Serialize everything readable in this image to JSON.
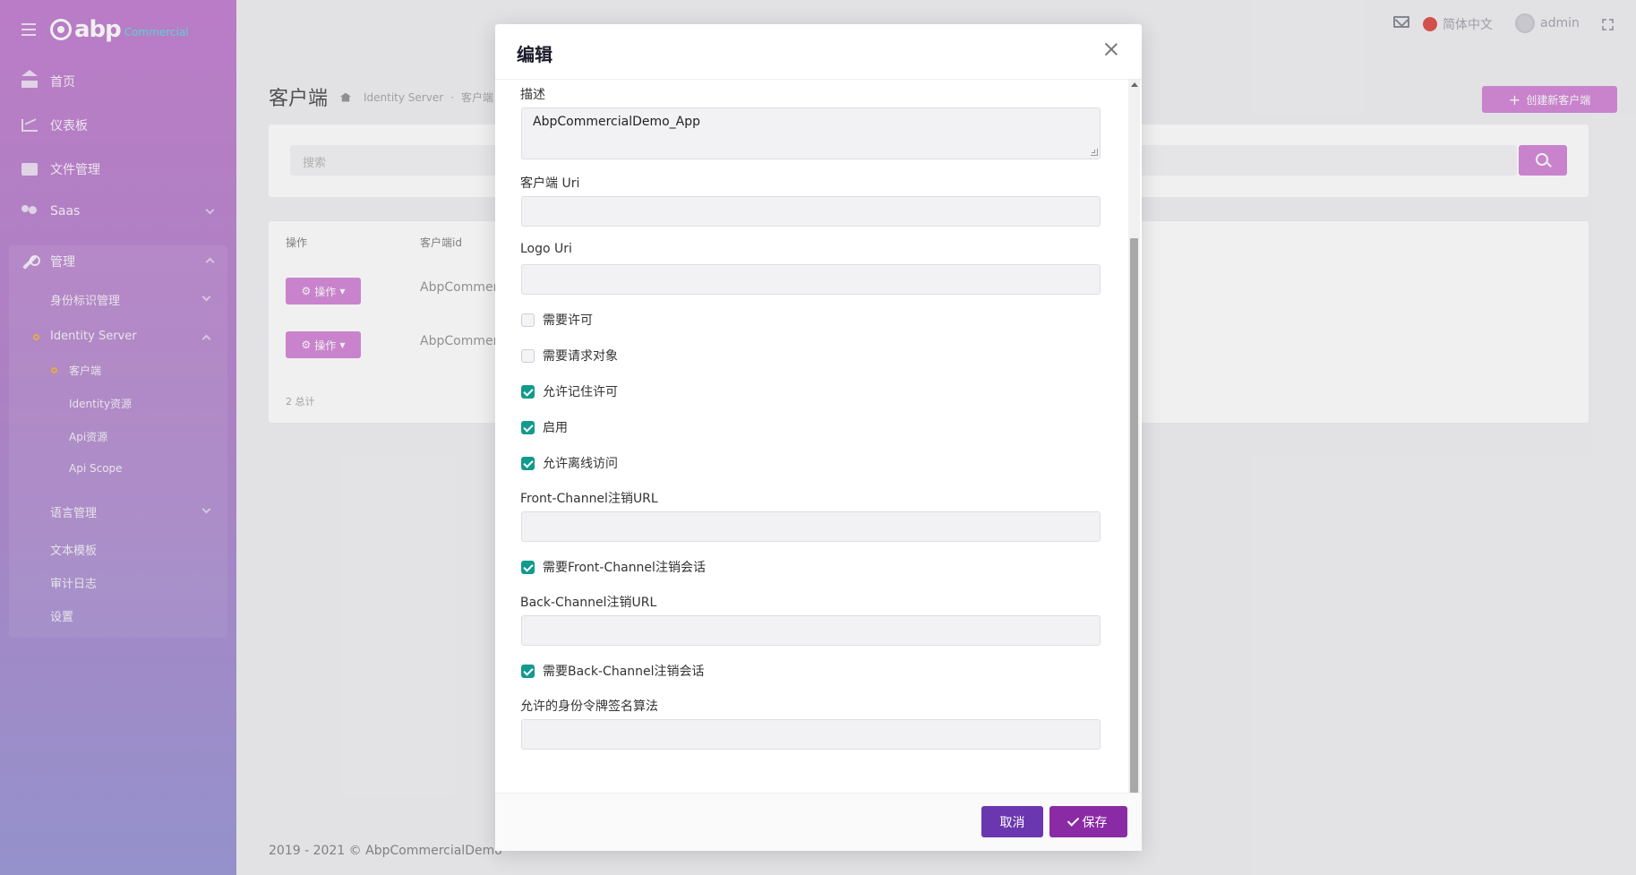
{
  "sidebar": {
    "brand": {
      "name": "abp",
      "sub": "Commercial"
    },
    "items": [
      {
        "label": "首页",
        "icon": "home-icon"
      },
      {
        "label": "仪表板",
        "icon": "chart-icon"
      },
      {
        "label": "文件管理",
        "icon": "folder-icon"
      },
      {
        "label": "Saas",
        "icon": "users-icon"
      },
      {
        "label": "管理",
        "icon": "wrench-icon"
      }
    ],
    "admin_children": {
      "identity": "身份标识管理",
      "identity_server": "Identity Server",
      "clients": "客户端",
      "identity_resources": "Identity资源",
      "api_resources": "Api资源",
      "api_scope": "Api Scope",
      "language": "语言管理",
      "text_templates": "文本模板",
      "audit_logs": "审计日志",
      "settings": "设置"
    }
  },
  "topbar": {
    "language": "简体中文",
    "user": "admin"
  },
  "page": {
    "title": "客户端",
    "breadcrumb": [
      "Identity Server",
      "客户端"
    ],
    "create_button": "创建新客户端",
    "search_placeholder": "搜索",
    "table": {
      "headers": [
        "操作",
        "客户端id"
      ],
      "rows": [
        {
          "action": "操作",
          "client_id": "AbpCommercialDemo_App"
        },
        {
          "action": "操作",
          "client_id": "AbpCommercialDemo_App"
        }
      ],
      "total": "2 总计"
    },
    "footer": "2019 - 2021 © AbpCommercialDemo"
  },
  "modal": {
    "title": "编辑",
    "fields": {
      "description": {
        "label": "描述",
        "value": "AbpCommercialDemo_App"
      },
      "client_uri": {
        "label": "客户端 Uri",
        "value": ""
      },
      "logo_uri": {
        "label": "Logo Uri",
        "value": ""
      },
      "front_channel_url": {
        "label": "Front-Channel注销URL",
        "value": ""
      },
      "back_channel_url": {
        "label": "Back-Channel注销URL",
        "value": ""
      },
      "signing_algorithms": {
        "label": "允许的身份令牌签名算法",
        "value": ""
      }
    },
    "checkboxes": {
      "require_consent": {
        "label": "需要许可",
        "checked": false
      },
      "require_request_object": {
        "label": "需要请求对象",
        "checked": false
      },
      "allow_remember_consent": {
        "label": "允许记住许可",
        "checked": true
      },
      "enabled": {
        "label": "启用",
        "checked": true
      },
      "allow_offline_access": {
        "label": "允许离线访问",
        "checked": true
      },
      "front_channel_session": {
        "label": "需要Front-Channel注销会话",
        "checked": true
      },
      "back_channel_session": {
        "label": "需要Back-Channel注销会话",
        "checked": true
      }
    },
    "buttons": {
      "cancel": "取消",
      "save": "保存"
    }
  },
  "colors": {
    "accent": "#8b2aa5",
    "cancel": "#6b37b0",
    "checkbox": "#129a8e",
    "create": "#d58cd9"
  }
}
